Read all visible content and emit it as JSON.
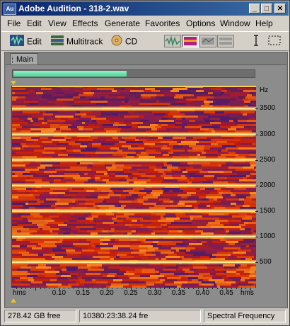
{
  "window": {
    "app_icon_text": "Au",
    "title": "Adobe Audition - 318-2.wav",
    "minimize": "_",
    "maximize": "□",
    "close": "✕"
  },
  "menu": [
    "File",
    "Edit",
    "View",
    "Effects",
    "Generate",
    "Favorites",
    "Options",
    "Window",
    "Help"
  ],
  "toolbar": {
    "edit_label": "Edit",
    "multitrack_label": "Multitrack",
    "cd_label": "CD",
    "edit_icon": "waveform-edit-icon",
    "multitrack_icon": "multitrack-icon",
    "cd_icon": "cd-icon",
    "active_view": "spectral"
  },
  "panel": {
    "tab_label": "Main",
    "overview_fraction": 0.47,
    "overview_color": "#4fd39c"
  },
  "spectrogram": {
    "freq_axis_unit": "Hz",
    "freq_labels": [
      "3500",
      "3000",
      "2500",
      "2000",
      "1500",
      "1000",
      "500"
    ],
    "freq_max": 3950,
    "freq_values": [
      3500,
      3000,
      2500,
      2000,
      1500,
      1000,
      500
    ],
    "harmonics_hz": [
      3500,
      3000,
      2500,
      2000,
      1500,
      1000,
      500
    ],
    "time_start_label": "hms",
    "time_end_label": "hms",
    "time_labels": [
      "0.10",
      "0.15",
      "0.20",
      "0.25",
      "0.30",
      "0.35",
      "0.40",
      "0.45"
    ],
    "time_values": [
      0.1,
      0.15,
      0.2,
      0.25,
      0.3,
      0.35,
      0.4,
      0.45
    ],
    "time_max": 0.51
  },
  "status": {
    "disk_free": "278.42 GB free",
    "time_free": "10380:23:38.24 fre",
    "view_mode": "Spectral Frequency"
  }
}
